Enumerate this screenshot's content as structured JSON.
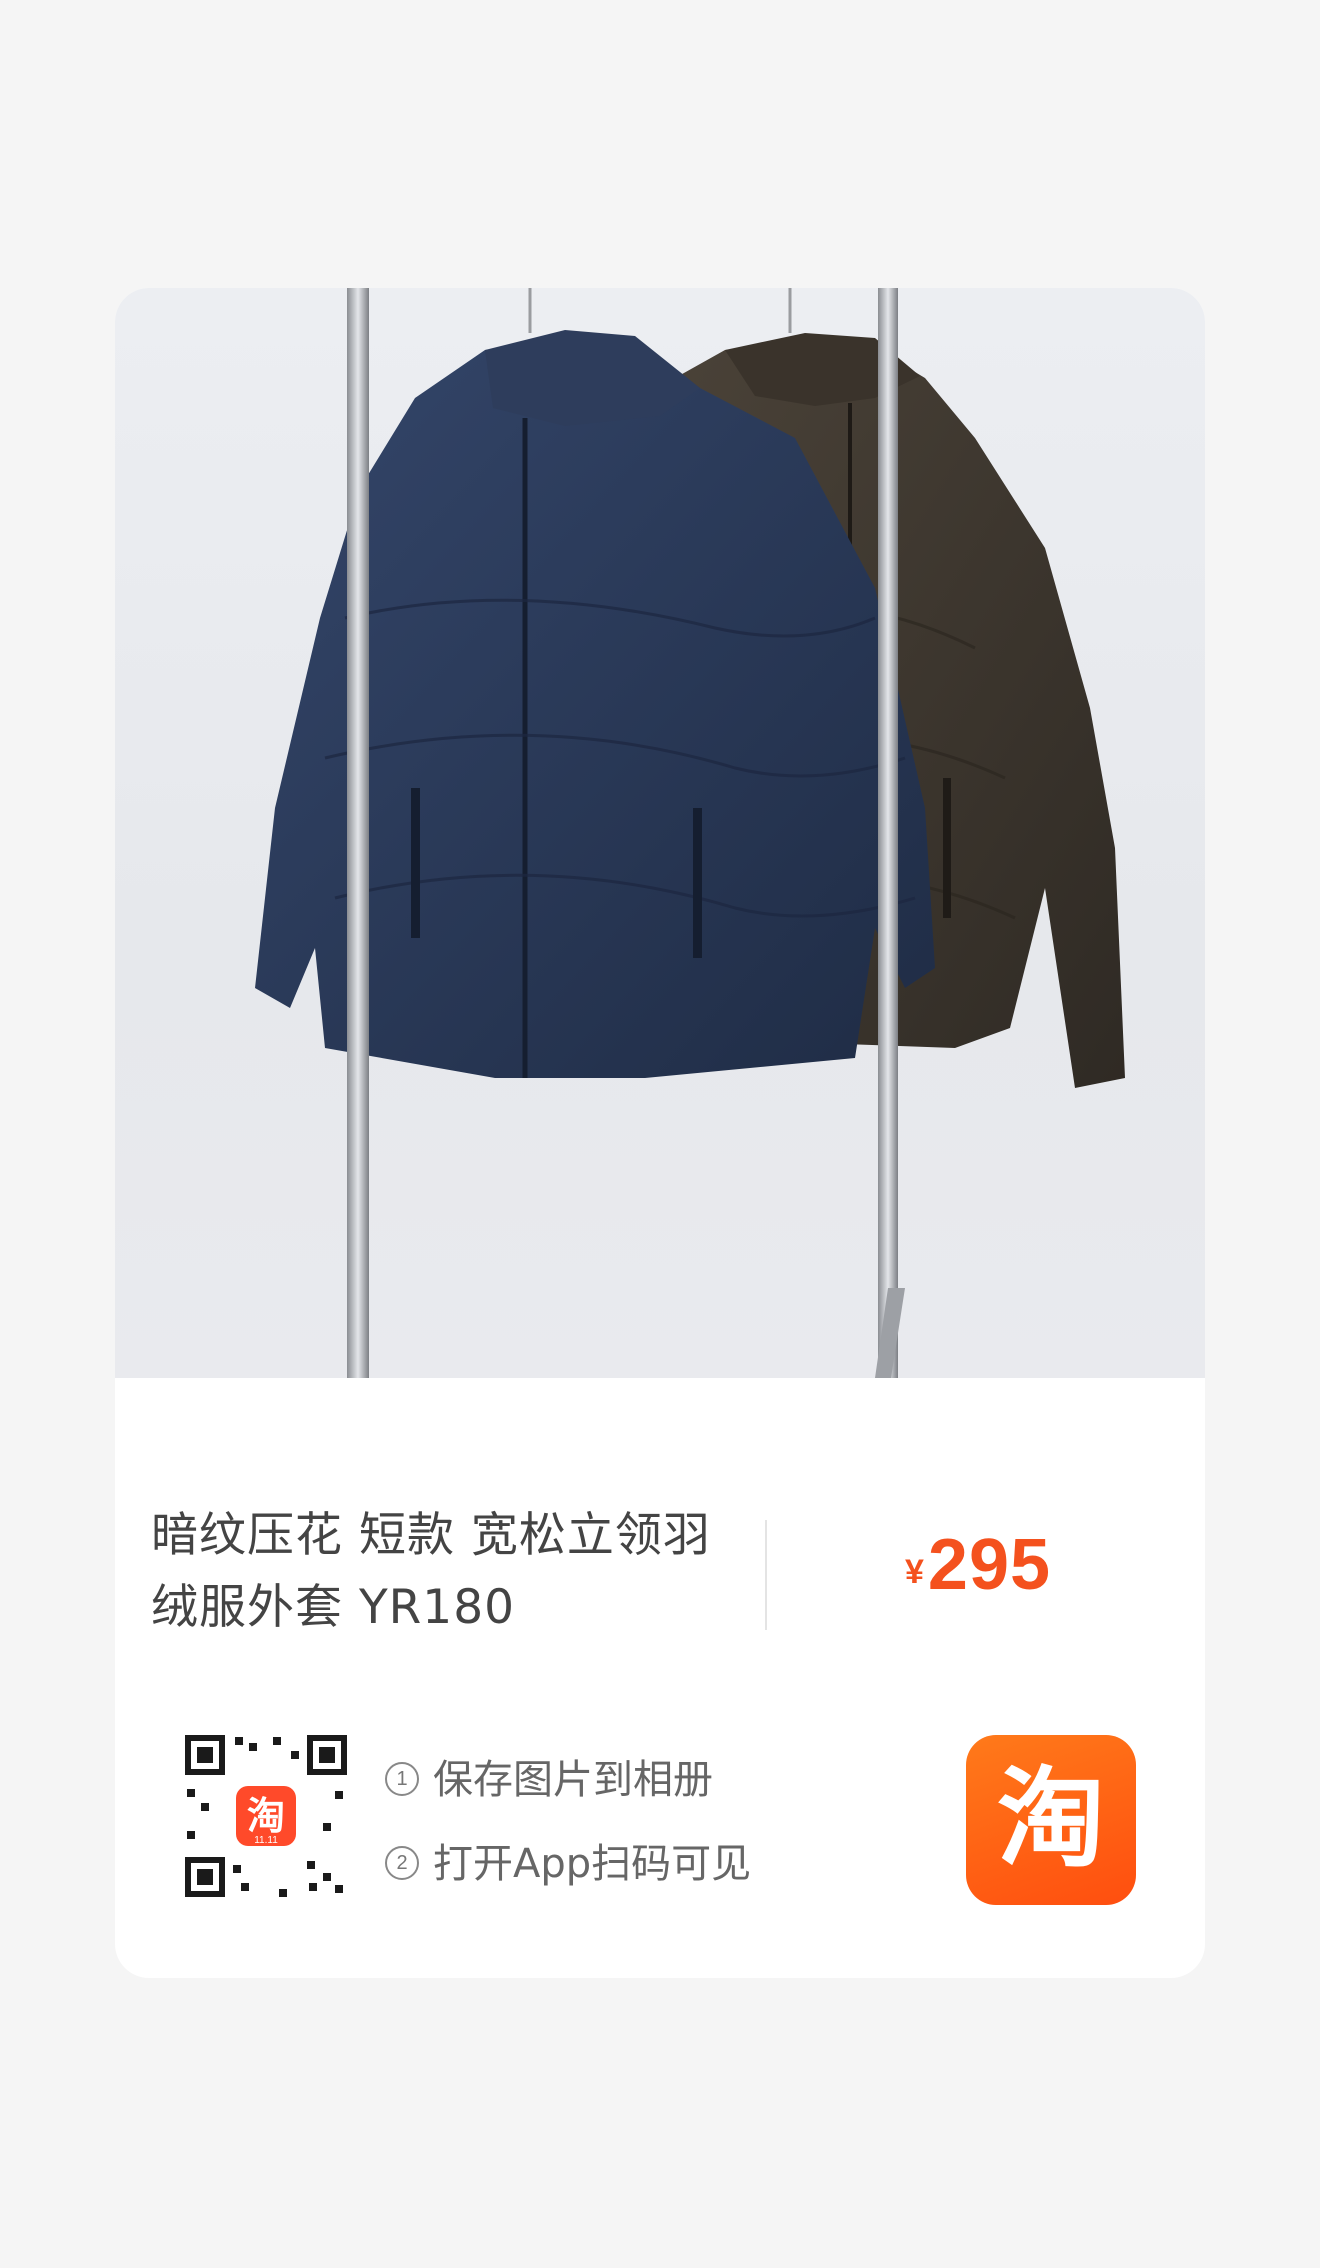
{
  "product": {
    "title": "暗纹压花 短款 宽松立领羽绒服外套 YR180",
    "currency_symbol": "¥",
    "price": "295",
    "image_alt": "navy and dark brown quilted down jackets on clothing rack"
  },
  "qr": {
    "badge_text": "淘",
    "badge_sub": "11.11"
  },
  "steps": [
    {
      "num": "1",
      "text": "保存图片到相册"
    },
    {
      "num": "2",
      "text": "打开App扫码可见"
    }
  ],
  "app_logo": {
    "glyph": "淘",
    "icon": "taobao-logo-icon"
  },
  "colors": {
    "price": "#f4511e",
    "logo": "#ff5a12",
    "navy_jacket": "#2b3a57",
    "brown_jacket": "#3b342c"
  }
}
